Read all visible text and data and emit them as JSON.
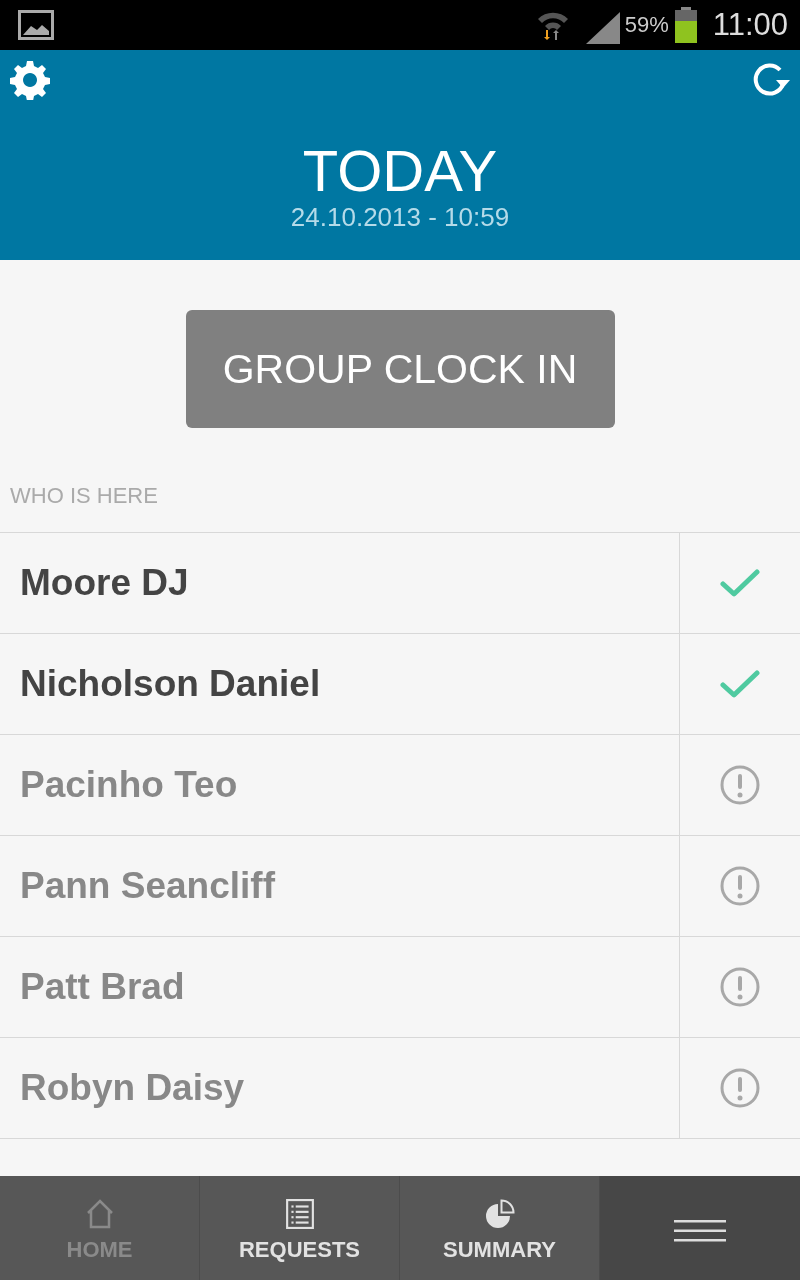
{
  "status_bar": {
    "battery_text": "59%",
    "time": "11:00"
  },
  "header": {
    "title": "TODAY",
    "subtitle": "24.10.2013 - 10:59"
  },
  "group_button": {
    "label": "GROUP CLOCK IN"
  },
  "section_label": "WHO IS HERE",
  "people": [
    {
      "name": "Moore DJ",
      "checked_in": true
    },
    {
      "name": "Nicholson Daniel",
      "checked_in": true
    },
    {
      "name": "Pacinho Teo",
      "checked_in": false
    },
    {
      "name": "Pann Seancliff",
      "checked_in": false
    },
    {
      "name": "Patt Brad",
      "checked_in": false
    },
    {
      "name": "Robyn Daisy",
      "checked_in": false
    }
  ],
  "tabs": [
    {
      "kind": "home",
      "label": "HOME",
      "selected": true
    },
    {
      "kind": "requests",
      "label": "REQUESTS",
      "selected": false
    },
    {
      "kind": "summary",
      "label": "SUMMARY",
      "selected": false
    },
    {
      "kind": "menu",
      "selected": false
    }
  ]
}
